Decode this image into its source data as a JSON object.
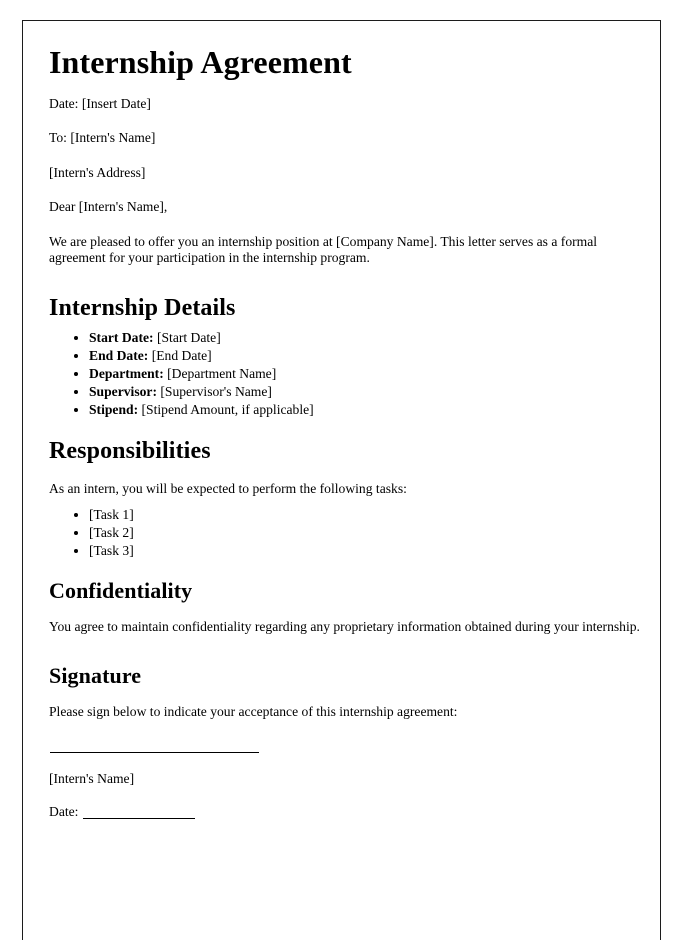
{
  "document": {
    "title": "Internship Agreement",
    "header_lines": [
      "Date: [Insert Date]",
      "To: [Intern's Name]",
      "[Intern's Address]",
      "Dear [Intern's Name],"
    ],
    "intro_paragraph": "We are pleased to offer you an internship position at [Company Name]. This letter serves as a formal agreement for your participation in the internship program.",
    "sections": {
      "details": {
        "heading": "Internship Details",
        "items": [
          {
            "label": "Start Date:",
            "value": "[Start Date]"
          },
          {
            "label": "End Date:",
            "value": "[End Date]"
          },
          {
            "label": "Department:",
            "value": "[Department Name]"
          },
          {
            "label": "Supervisor:",
            "value": "[Supervisor's Name]"
          },
          {
            "label": "Stipend:",
            "value": "[Stipend Amount, if applicable]"
          }
        ]
      },
      "responsibilities": {
        "heading": "Responsibilities",
        "intro": "As an intern, you will be expected to perform the following tasks:",
        "tasks": [
          "[Task 1]",
          "[Task 2]",
          "[Task 3]"
        ]
      },
      "confidentiality": {
        "heading": "Confidentiality",
        "body": "You agree to maintain confidentiality regarding any proprietary information obtained during your internship."
      },
      "signature": {
        "heading": "Signature",
        "instruction": "Please sign below to indicate your acceptance of this internship agreement:",
        "signer_name": "[Intern's Name]",
        "date_label": "Date:"
      }
    }
  }
}
